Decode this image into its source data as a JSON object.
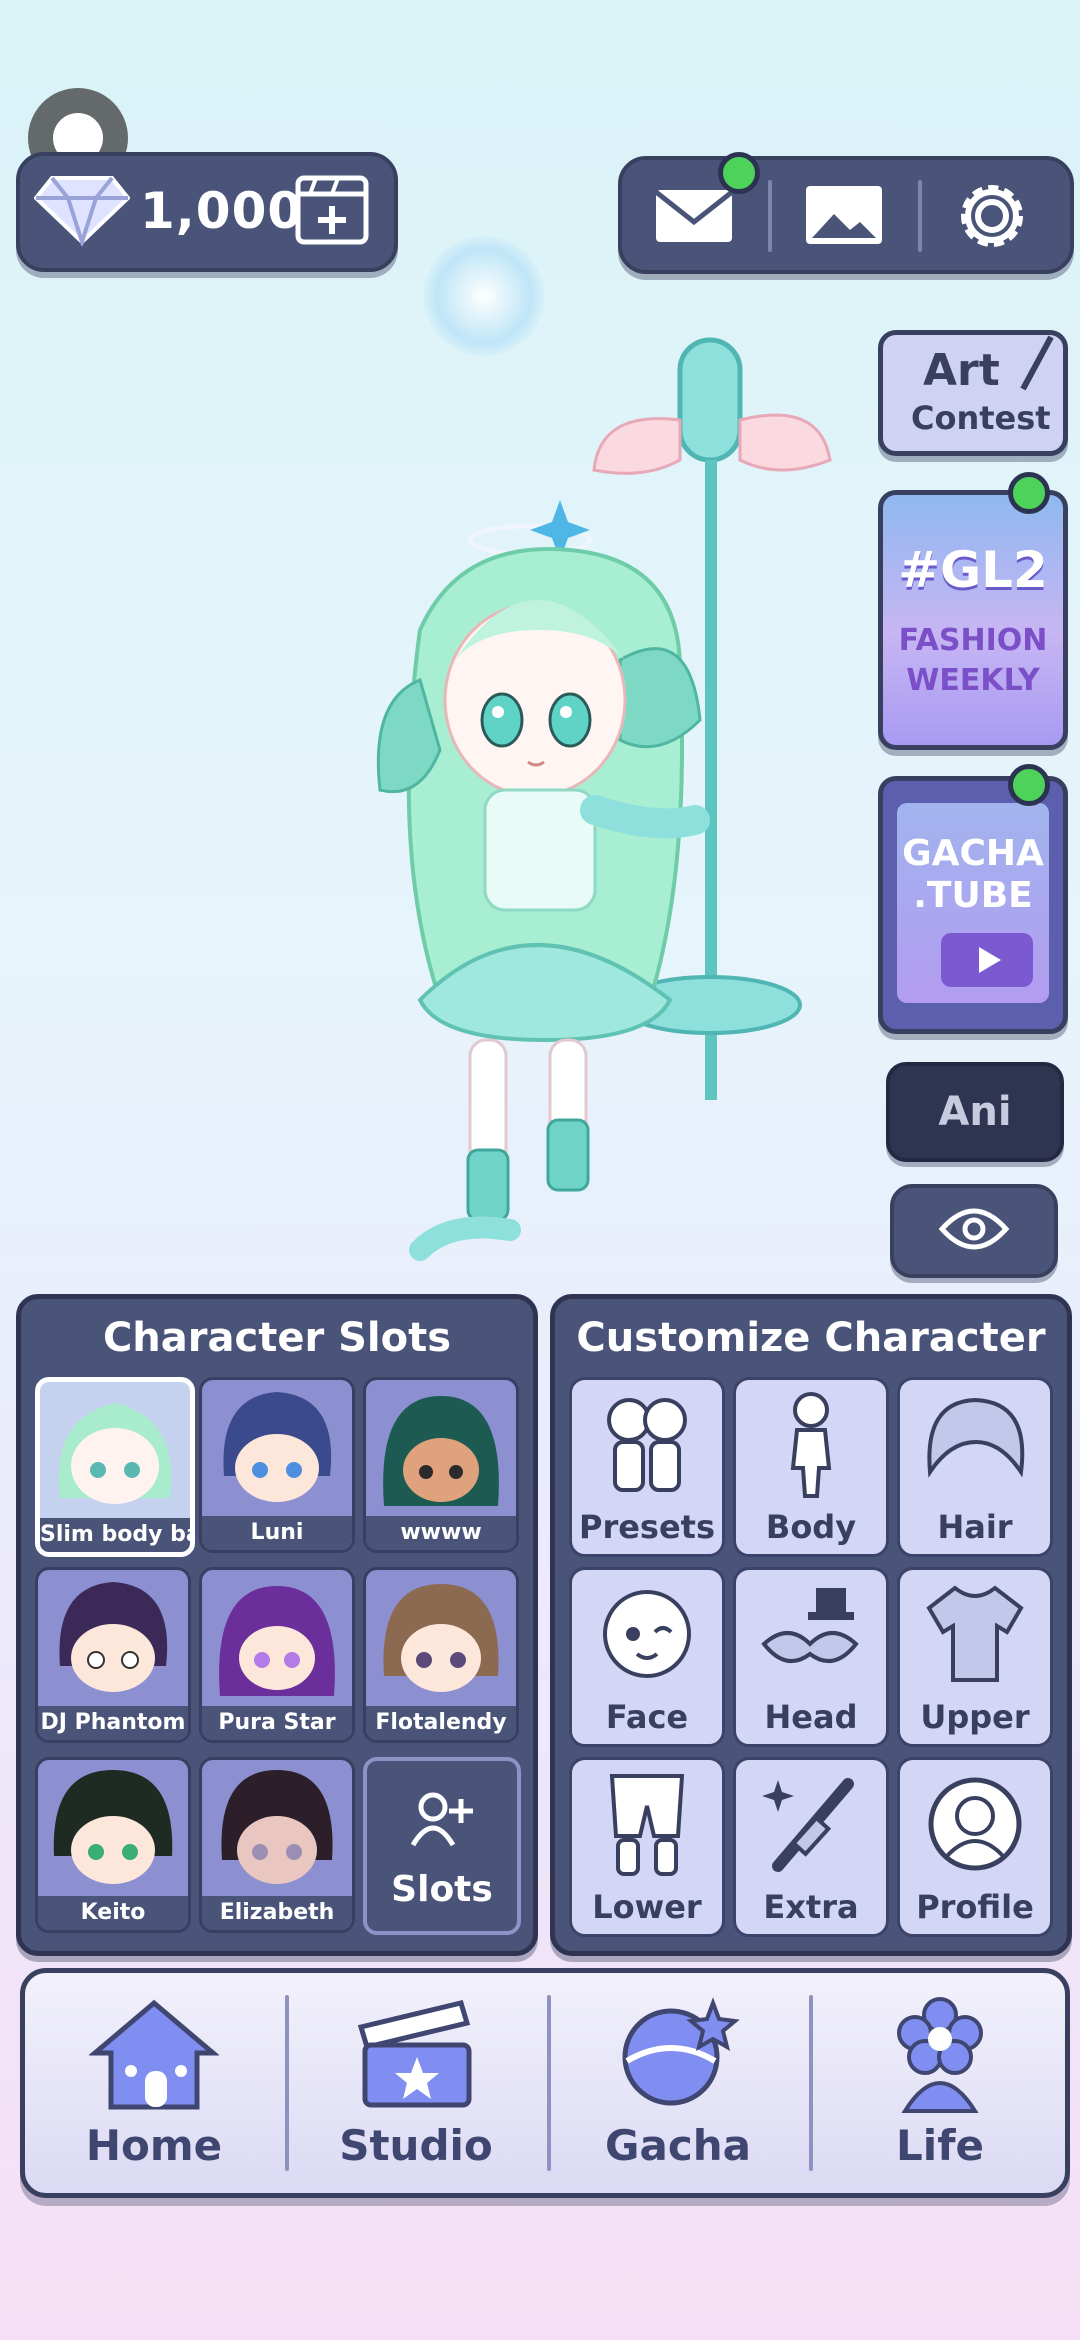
{
  "currency": {
    "gems": "1,000"
  },
  "side_buttons": {
    "art_contest": {
      "line1": "Art",
      "line2": "Contest"
    },
    "gl2": {
      "title": "#GL2",
      "line1": "FASHION",
      "line2": "WEEKLY"
    },
    "gacha_tube": {
      "line1": "GACHA",
      "line2": ".TUBE"
    },
    "ani": "Ani"
  },
  "character_slots": {
    "title": "Character Slots",
    "slots": [
      "Slim body bas",
      "Luni",
      "wwww",
      "DJ Phantom",
      "Pura Star",
      "Flotalendy",
      "Keito",
      "Elizabeth"
    ],
    "add_label": "Slots"
  },
  "customize": {
    "title": "Customize Character",
    "items": [
      "Presets",
      "Body",
      "Hair",
      "Face",
      "Head",
      "Upper",
      "Lower",
      "Extra",
      "Profile"
    ]
  },
  "nav": {
    "items": [
      "Home",
      "Studio",
      "Gacha",
      "Life"
    ]
  },
  "colors": {
    "panel": "#4a5478",
    "panel_border": "#2e3452",
    "tile": "#d3d6f5",
    "notif": "#4ed35a"
  },
  "icons": [
    "diamond-icon",
    "add-video-icon",
    "mail-icon",
    "gallery-icon",
    "gear-icon",
    "eye-icon",
    "play-icon",
    "add-person-icon",
    "house-icon",
    "clapperboard-icon",
    "gacha-ball-icon",
    "flower-icon"
  ]
}
